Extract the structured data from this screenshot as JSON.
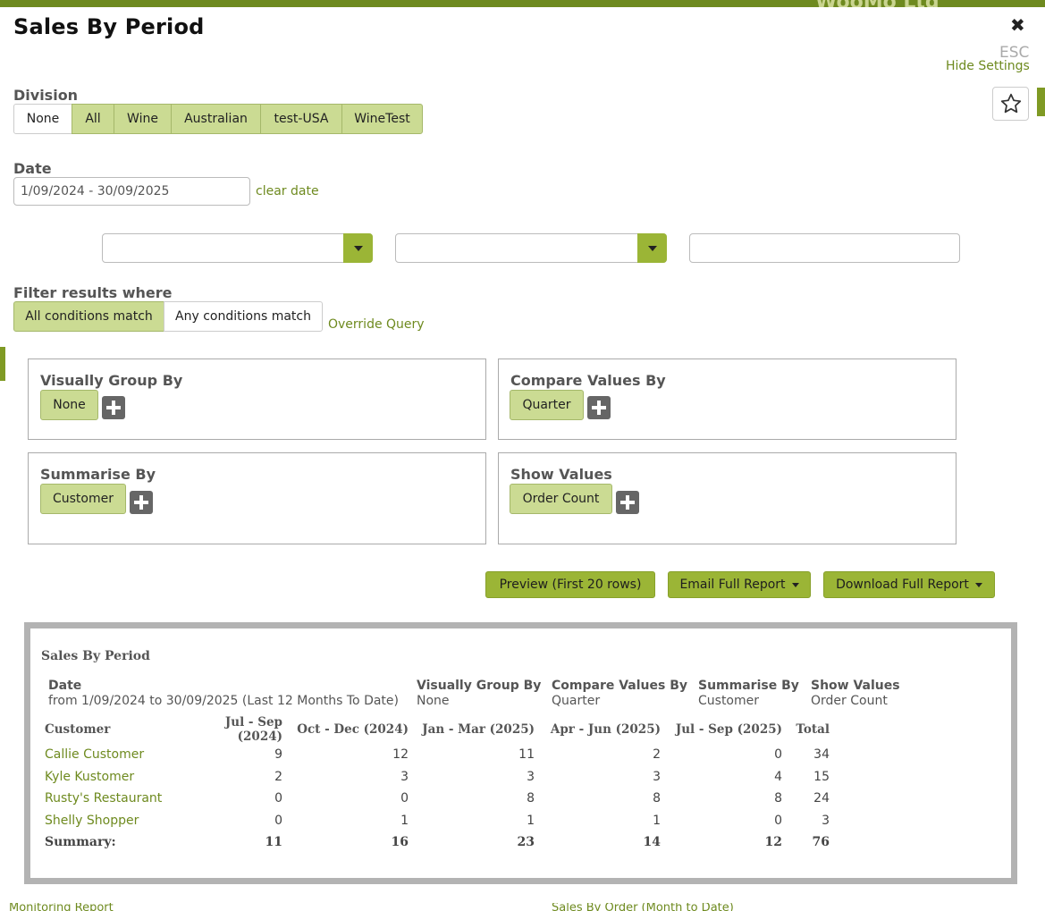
{
  "background": {
    "brand": "WooMo Ltd",
    "bottom_left_text": "Monitoring Report",
    "bottom_right_text": "Sales By Order (Month to Date)"
  },
  "modal": {
    "title": "Sales By Period",
    "close_icon": "close-icon",
    "esc_label": "ESC",
    "hide_settings": "Hide Settings",
    "favorite_icon": "star-icon"
  },
  "division": {
    "label": "Division",
    "options": [
      "None",
      "All",
      "Wine",
      "Australian",
      "test-USA",
      "WineTest"
    ],
    "selected": [
      "All",
      "Wine",
      "Australian",
      "test-USA",
      "WineTest"
    ]
  },
  "date": {
    "label": "Date",
    "value": "1/09/2024 - 30/09/2025",
    "clear_link": "clear date"
  },
  "filter": {
    "label": "Filter results where",
    "all_match": "All conditions match",
    "any_match": "Any conditions match",
    "override": "Override Query"
  },
  "panels": {
    "visually_group_by": {
      "title": "Visually Group By",
      "chip": "None"
    },
    "compare_values_by": {
      "title": "Compare Values By",
      "chip": "Quarter"
    },
    "summarise_by": {
      "title": "Summarise By",
      "chip": "Customer"
    },
    "show_values": {
      "title": "Show Values",
      "chip": "Order Count"
    }
  },
  "actions": {
    "preview": "Preview (First 20 rows)",
    "email": "Email Full Report",
    "download": "Download Full Report"
  },
  "report": {
    "title": "Sales By Period",
    "meta": {
      "date_label": "Date",
      "date_value": "from 1/09/2024 to 30/09/2025 (Last 12 Months To Date)",
      "group_label": "Visually Group By",
      "group_value": "None",
      "compare_label": "Compare Values By",
      "compare_value": "Quarter",
      "summarise_label": "Summarise By",
      "summarise_value": "Customer",
      "show_label": "Show Values",
      "show_value": "Order Count"
    },
    "columns": [
      "Customer",
      "Jul - Sep (2024)",
      "Oct - Dec (2024)",
      "Jan - Mar (2025)",
      "Apr - Jun (2025)",
      "Jul - Sep (2025)",
      "Total"
    ],
    "rows": [
      {
        "customer": "Callie Customer",
        "values": [
          "9",
          "12",
          "11",
          "2",
          "0",
          "34"
        ]
      },
      {
        "customer": "Kyle Kustomer",
        "values": [
          "2",
          "3",
          "3",
          "3",
          "4",
          "15"
        ]
      },
      {
        "customer": "Rusty's Restaurant",
        "values": [
          "0",
          "0",
          "8",
          "8",
          "8",
          "24"
        ]
      },
      {
        "customer": "Shelly Shopper",
        "values": [
          "0",
          "1",
          "1",
          "1",
          "0",
          "3"
        ]
      }
    ],
    "summary": {
      "label": "Summary:",
      "values": [
        "11",
        "16",
        "23",
        "14",
        "12",
        "76"
      ]
    }
  }
}
